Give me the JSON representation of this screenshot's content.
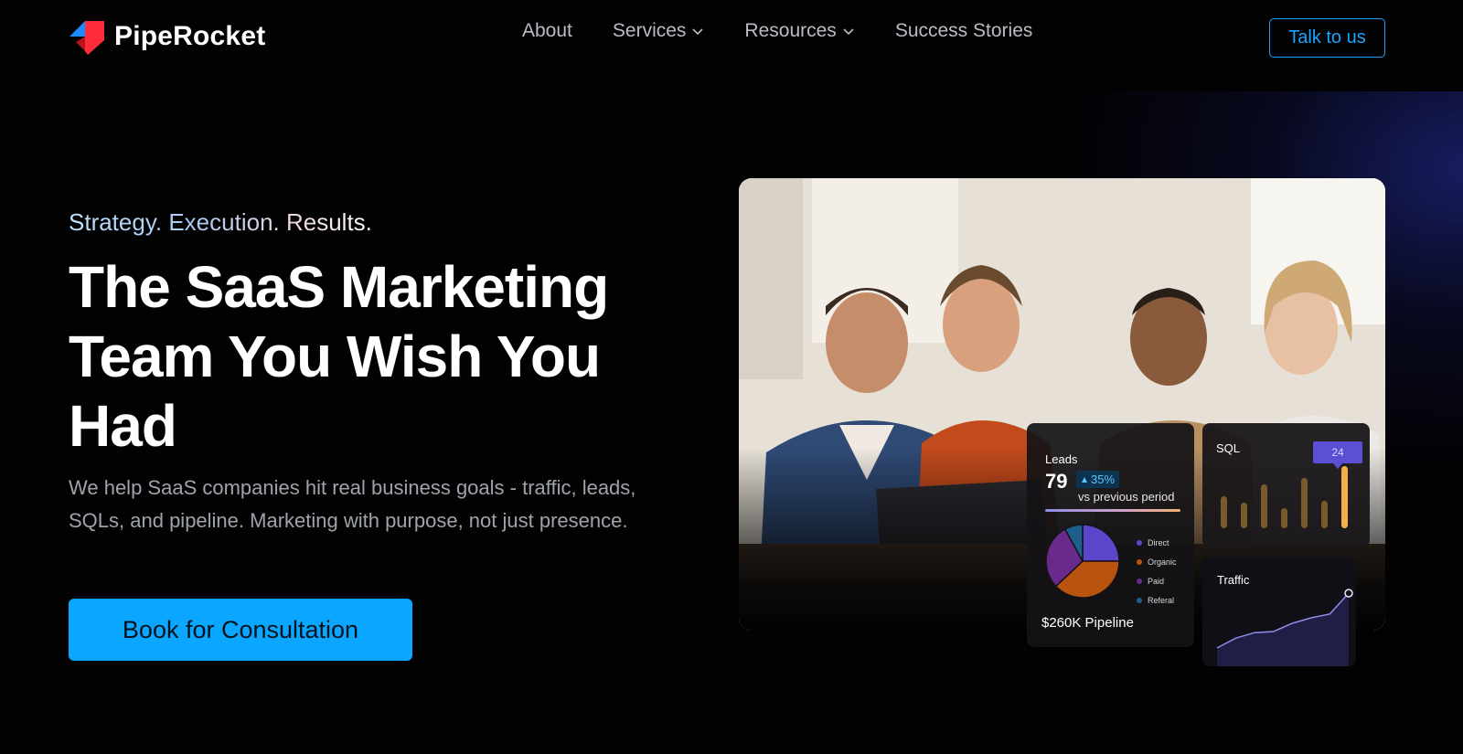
{
  "brand": {
    "name": "PipeRocket",
    "logo_icon": "piperocket-logo-icon"
  },
  "nav": {
    "links": [
      {
        "label": "About",
        "has_dropdown": false
      },
      {
        "label": "Services",
        "has_dropdown": true
      },
      {
        "label": "Resources",
        "has_dropdown": true
      },
      {
        "label": "Success Stories",
        "has_dropdown": false
      }
    ],
    "cta_label": "Talk to us"
  },
  "hero": {
    "tagline": "Strategy. Execution. Results.",
    "headline_lines": [
      "The SaaS Marketing",
      "Team You Wish You",
      "Had"
    ],
    "subtext": "We help SaaS companies hit real business goals - traffic, leads, SQLs, and pipeline. Marketing with purpose, not just presence.",
    "cta_label": "Book for Consultation"
  },
  "dashboard": {
    "leads": {
      "title": "Leads",
      "value": "79",
      "change": "35%",
      "change_icon": "triangle-up-icon",
      "comparison": "vs previous period",
      "breakdown": [
        {
          "label": "Direct",
          "share": 0.25,
          "color": "#5b45c8"
        },
        {
          "label": "Organic",
          "share": 0.38,
          "color": "#b8540f"
        },
        {
          "label": "Paid",
          "share": 0.29,
          "color": "#6a2a8c"
        },
        {
          "label": "Referal",
          "share": 0.08,
          "color": "#1f5f8b"
        }
      ],
      "pipeline_text": "$260K Pipeline"
    },
    "sql": {
      "title": "SQL",
      "highlight_value": "24",
      "bars": [
        0.35,
        0.28,
        0.48,
        0.22,
        0.55,
        0.3,
        0.68
      ],
      "bar_color": "#7a5a2a",
      "highlight_color": "#f3b04a"
    },
    "traffic": {
      "title": "Traffic",
      "trend": [
        0.0,
        0.18,
        0.28,
        0.3,
        0.45,
        0.55,
        0.62,
        1.0
      ],
      "line_color": "#8e8ce8"
    }
  },
  "colors": {
    "accent": "#0aa6ff",
    "background": "#020203",
    "muted_text": "#9fa3ab"
  }
}
